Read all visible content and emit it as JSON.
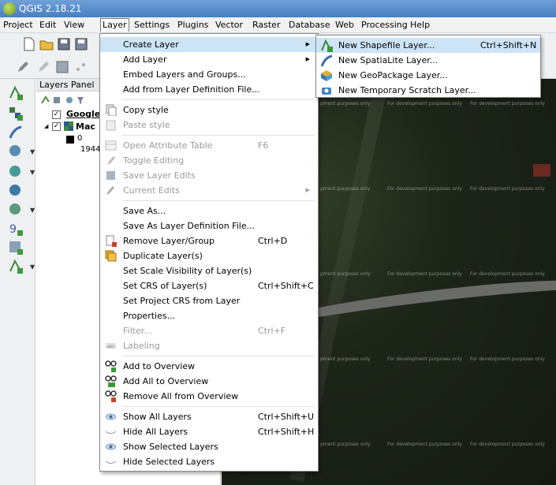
{
  "window": {
    "title": "QGIS 2.18.21"
  },
  "menubar": [
    "Project",
    "Edit",
    "View",
    "Layer",
    "Settings",
    "Plugins",
    "Vector",
    "Raster",
    "Database",
    "Web",
    "Processing",
    "Help"
  ],
  "layers_panel": {
    "title": "Layers Panel",
    "layer1": "Google",
    "layer2": "Mac",
    "legend_value": "0",
    "legend_value2": "1944"
  },
  "layer_menu": {
    "create_layer": "Create Layer",
    "add_layer": "Add Layer",
    "embed": "Embed Layers and Groups...",
    "add_from_def": "Add from Layer Definition File...",
    "copy_style": "Copy style",
    "paste_style": "Paste style",
    "open_attr": "Open Attribute Table",
    "open_attr_sc": "F6",
    "toggle_editing": "Toggle Editing",
    "save_edits": "Save Layer Edits",
    "current_edits": "Current Edits",
    "save_as": "Save As...",
    "save_as_def": "Save As Layer Definition File...",
    "remove": "Remove Layer/Group",
    "remove_sc": "Ctrl+D",
    "duplicate": "Duplicate Layer(s)",
    "scale_vis": "Set Scale Visibility of Layer(s)",
    "set_crs": "Set CRS of Layer(s)",
    "set_crs_sc": "Ctrl+Shift+C",
    "set_project_crs": "Set Project CRS from Layer",
    "properties": "Properties...",
    "filter": "Filter...",
    "filter_sc": "Ctrl+F",
    "labeling": "Labeling",
    "add_overview": "Add to Overview",
    "add_all_overview": "Add All to Overview",
    "remove_all_overview": "Remove All from Overview",
    "show_all": "Show All Layers",
    "show_all_sc": "Ctrl+Shift+U",
    "hide_all": "Hide All Layers",
    "hide_all_sc": "Ctrl+Shift+H",
    "show_selected": "Show Selected Layers",
    "hide_selected": "Hide Selected Layers"
  },
  "create_submenu": {
    "shapefile": "New Shapefile Layer...",
    "shapefile_sc": "Ctrl+Shift+N",
    "spatialite": "New SpatiaLite Layer...",
    "geopackage": "New GeoPackage Layer...",
    "scratch": "New Temporary Scratch Layer..."
  },
  "map": {
    "watermark": "For development purposes only",
    "watermark_short": "pment purposes only"
  }
}
